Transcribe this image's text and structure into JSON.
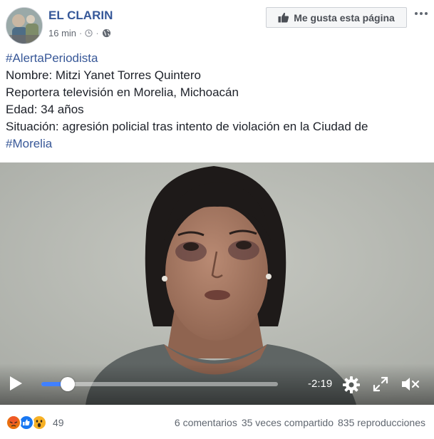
{
  "post": {
    "page_name": "EL CLARIN",
    "timestamp": "16 min",
    "like_page_label": "Me gusta esta página",
    "text": {
      "hashtag1": "#AlertaPeriodista",
      "line1": "Nombre: Mitzi Yanet Torres Quintero",
      "line2": "Reportera televisión en Morelia, Michoacán",
      "line3": "Edad: 34 años",
      "line4": "Situación: agresión policial tras intento de violación en la Ciudad de",
      "hashtag2": "#Morelia"
    }
  },
  "video": {
    "time_remaining": "-2:19",
    "progress": 0.11
  },
  "footer": {
    "reaction_count": "49",
    "reactions": [
      "angry-icon",
      "like-icon",
      "wow-icon"
    ],
    "comments": "6 comentarios",
    "shares": "35 veces compartido",
    "views": "835 reproducciones"
  },
  "colors": {
    "link": "#365899",
    "progress_fill": "#4080ff",
    "meta_text": "#606770"
  }
}
